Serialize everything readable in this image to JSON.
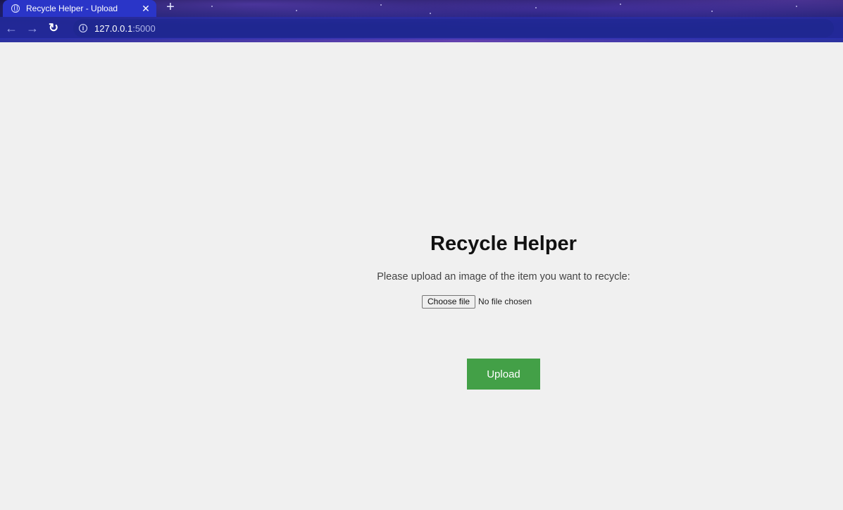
{
  "browser": {
    "tab": {
      "title": "Recycle Helper - Upload",
      "close_label": "✕",
      "favicon": "globe-icon"
    },
    "new_tab_label": "+",
    "toolbar": {
      "back_icon": "arrow-left-icon",
      "forward_icon": "arrow-right-icon",
      "reload_icon": "reload-icon",
      "url_host": "127.0.0.1",
      "url_port": ":5000",
      "site_info_icon": "info-icon"
    },
    "theme_colors": {
      "tab_active": "#2a35c8",
      "toolbar": "#1d1f78"
    }
  },
  "page": {
    "title": "Recycle Helper",
    "prompt": "Please upload an image of the item you want to recycle:",
    "file_input": {
      "button_label": "Choose file",
      "status": "No file chosen"
    },
    "upload_button": {
      "label": "Upload",
      "color": "#43a047"
    },
    "background": "#f0f0f0"
  }
}
